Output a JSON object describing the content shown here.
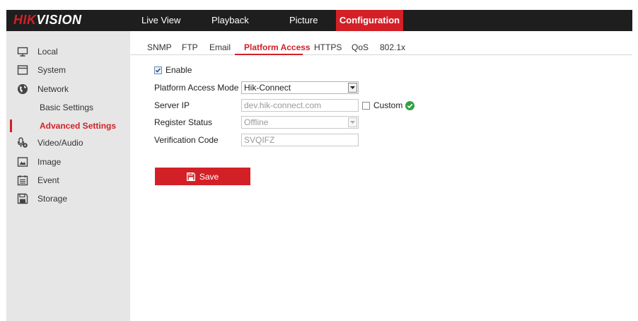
{
  "brand": {
    "logo_part1": "HIK",
    "logo_part2": "VISION"
  },
  "top_nav": [
    {
      "label": "Live View"
    },
    {
      "label": "Playback"
    },
    {
      "label": "Picture"
    },
    {
      "label": "Configuration",
      "active": true
    }
  ],
  "sidebar": {
    "items": [
      {
        "label": "Local",
        "icon": "monitor-icon"
      },
      {
        "label": "System",
        "icon": "system-icon"
      },
      {
        "label": "Network",
        "icon": "network-globe-icon"
      },
      {
        "label": "Basic Settings"
      },
      {
        "label": "Advanced Settings",
        "active": true
      },
      {
        "label": "Video/Audio",
        "icon": "video-audio-icon"
      },
      {
        "label": "Image",
        "icon": "image-icon"
      },
      {
        "label": "Event",
        "icon": "event-calendar-icon"
      },
      {
        "label": "Storage",
        "icon": "storage-icon"
      }
    ]
  },
  "sub_tabs": [
    {
      "label": "SNMP"
    },
    {
      "label": "FTP"
    },
    {
      "label": "Email"
    },
    {
      "label": "Platform Access",
      "active": true
    },
    {
      "label": "HTTPS"
    },
    {
      "label": "QoS"
    },
    {
      "label": "802.1x"
    }
  ],
  "form": {
    "enable_label": "Enable",
    "enable_checked": true,
    "platform_access_mode": {
      "label": "Platform Access Mode",
      "value": "Hik-Connect"
    },
    "server_ip": {
      "label": "Server IP",
      "value": "dev.hik-connect.com",
      "custom_label": "Custom",
      "custom_checked": false
    },
    "register_status": {
      "label": "Register Status",
      "value": "Offline"
    },
    "verification_code": {
      "label": "Verification Code",
      "value": "SVQIFZ"
    },
    "save_label": "Save"
  },
  "colors": {
    "accent": "#d32027",
    "topbar": "#1e1e1e",
    "sidebar": "#e6e6e6",
    "status_ok": "#2ea043"
  }
}
